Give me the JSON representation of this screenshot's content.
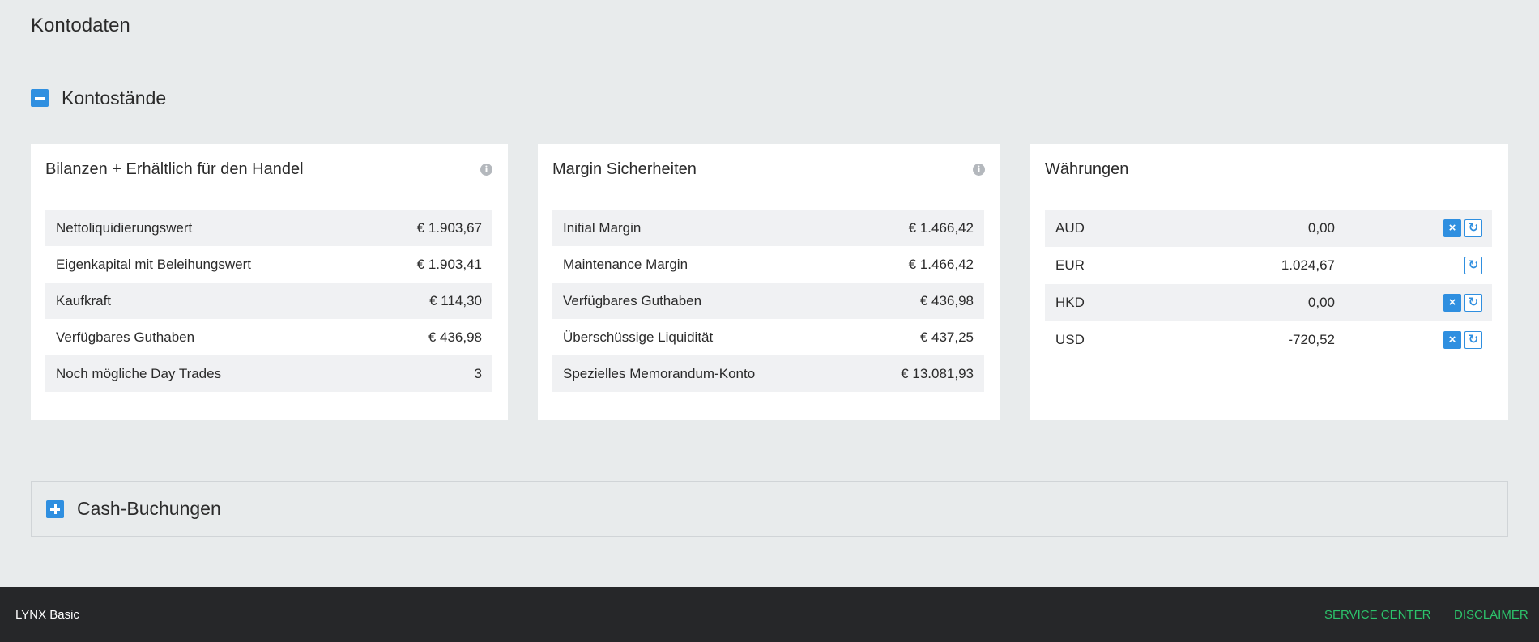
{
  "page": {
    "title": "Kontodaten"
  },
  "balances_section": {
    "label": "Kontostände",
    "toggle": "minus"
  },
  "balances_card": {
    "title": "Bilanzen + Erhältlich für den Handel",
    "rows": [
      {
        "label": "Nettoliquidierungswert",
        "value": "€ 1.903,67"
      },
      {
        "label": "Eigenkapital mit Beleihungswert",
        "value": "€ 1.903,41"
      },
      {
        "label": "Kaufkraft",
        "value": "€ 114,30"
      },
      {
        "label": "Verfügbares Guthaben",
        "value": "€ 436,98"
      },
      {
        "label": "Noch mögliche Day Trades",
        "value": "3"
      }
    ]
  },
  "margin_card": {
    "title": "Margin Sicherheiten",
    "rows": [
      {
        "label": "Initial Margin",
        "value": "€ 1.466,42"
      },
      {
        "label": "Maintenance Margin",
        "value": "€ 1.466,42"
      },
      {
        "label": "Verfügbares Guthaben",
        "value": "€ 436,98"
      },
      {
        "label": "Überschüssige Liquidität",
        "value": "€ 437,25"
      },
      {
        "label": "Spezielles Memorandum-Konto",
        "value": "€ 13.081,93"
      }
    ]
  },
  "currency_card": {
    "title": "Währungen",
    "rows": [
      {
        "code": "AUD",
        "amount": "0,00",
        "removable": true
      },
      {
        "code": "EUR",
        "amount": "1.024,67",
        "removable": false
      },
      {
        "code": "HKD",
        "amount": "0,00",
        "removable": true
      },
      {
        "code": "USD",
        "amount": "-720,52",
        "removable": true
      }
    ]
  },
  "cash_section": {
    "label": "Cash-Buchungen",
    "toggle": "plus"
  },
  "footer": {
    "brand": "LYNX Basic",
    "service_center": "SERVICE CENTER",
    "disclaimer": "DISCLAIMER"
  },
  "colors": {
    "accent": "#2f8fe0",
    "background": "#e8ebec",
    "footer_bg": "#262729",
    "footer_link": "#2cc36b"
  },
  "icons": {
    "info": "info-circle-icon",
    "remove": "close-icon",
    "refresh": "refresh-icon"
  }
}
